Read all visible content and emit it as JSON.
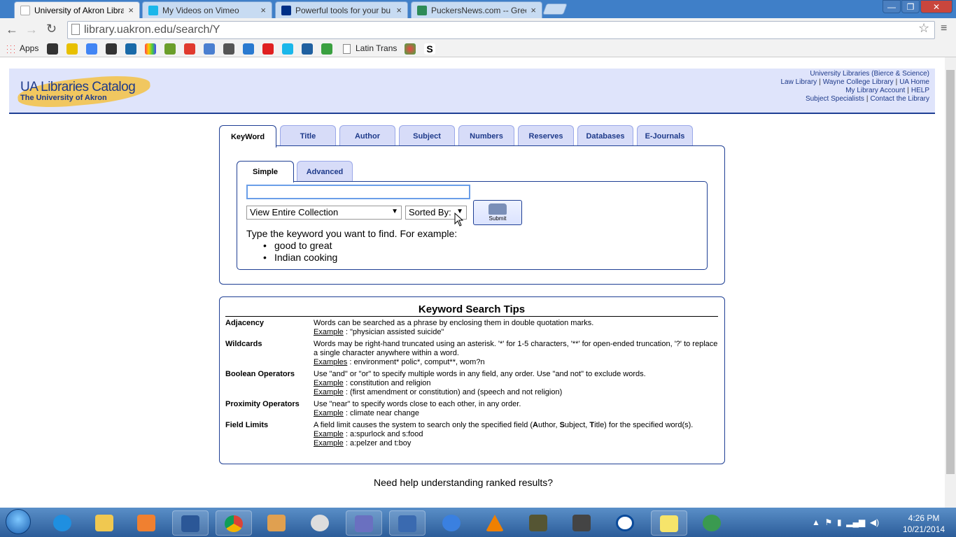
{
  "browser": {
    "tabs": [
      {
        "title": "University of Akron Librari",
        "active": true,
        "favicon_color": "#ffffff"
      },
      {
        "title": "My Videos on Vimeo",
        "active": false,
        "favicon_color": "#1ab7ea"
      },
      {
        "title": "Powerful tools for your bu",
        "active": false,
        "favicon_color": "#003087"
      },
      {
        "title": "PuckersNews.com -- Gree",
        "active": false,
        "favicon_color": "#2e8b57"
      }
    ],
    "close_glyph": "×",
    "url": "library.uakron.edu/search/Y",
    "bookmarks": {
      "apps": "Apps",
      "latin": "Latin Trans"
    }
  },
  "header": {
    "title": "UA Libraries Catalog",
    "subtitle": "The University of Akron",
    "links": {
      "university_libraries": "University Libraries (Bierce & Science)",
      "law_library": "Law Library",
      "wayne_college": "Wayne College Library",
      "ua_home": "UA Home",
      "my_account": "My Library Account",
      "help": "HELP",
      "subject_specialists": "Subject Specialists",
      "contact": "Contact the Library"
    },
    "separator": "|"
  },
  "search_tabs": [
    "KeyWord",
    "Title",
    "Author",
    "Subject",
    "Numbers",
    "Reserves",
    "Databases",
    "E-Journals"
  ],
  "sub_tabs": [
    "Simple",
    "Advanced"
  ],
  "search": {
    "keyword_value": "",
    "collection": "View Entire Collection",
    "sort": "Sorted By:",
    "submit_label": "Submit",
    "hint": "Type the keyword you want to find. For example:",
    "examples": [
      "good to great",
      "Indian cooking"
    ]
  },
  "tips": {
    "title": "Keyword Search Tips",
    "rows": [
      {
        "term": "Adjacency",
        "line1": "Words can be searched as a phrase by enclosing them in double quotation marks.",
        "ex1_label": "Example",
        "ex1_text": " : \"physician assisted suicide\""
      },
      {
        "term": "Wildcards",
        "line1": "Words may be right-hand truncated using an asterisk. '*' for 1-5 characters, '**' for open-ended truncation, '?' to replace a single character anywhere within a word.",
        "ex1_label": "Examples",
        "ex1_text": " : environment* polic*, comput**, wom?n"
      },
      {
        "term": "Boolean Operators",
        "line1": "Use \"and\" or \"or\" to specify multiple words in any field, any order. Use \"and not\" to exclude words.",
        "ex1_label": "Example",
        "ex1_text": " : constitution and religion",
        "ex2_label": "Example",
        "ex2_text": " : (first amendment or constitution) and (speech and not religion)"
      },
      {
        "term": "Proximity Operators",
        "line1": "Use \"near\" to specify words close to each other, in any order.",
        "ex1_label": "Example",
        "ex1_text": " : climate near change"
      },
      {
        "term": "Field Limits",
        "line1_a": "A field limit causes the system to search only the specified field (",
        "line1_author_b": "A",
        "line1_author_rest": "uthor, ",
        "line1_subject_b": "S",
        "line1_subject_rest": "ubject, ",
        "line1_title_b": "T",
        "line1_title_rest": "itle) for the specified word(s).",
        "ex1_label": "Example",
        "ex1_text": " : a:spurlock and s:food",
        "ex2_label": "Example",
        "ex2_text": " : a:pelzer and t:boy"
      }
    ]
  },
  "ranked_help": "Need help understanding ranked results?",
  "taskbar": {
    "time": "4:26 PM",
    "date": "10/21/2014"
  }
}
